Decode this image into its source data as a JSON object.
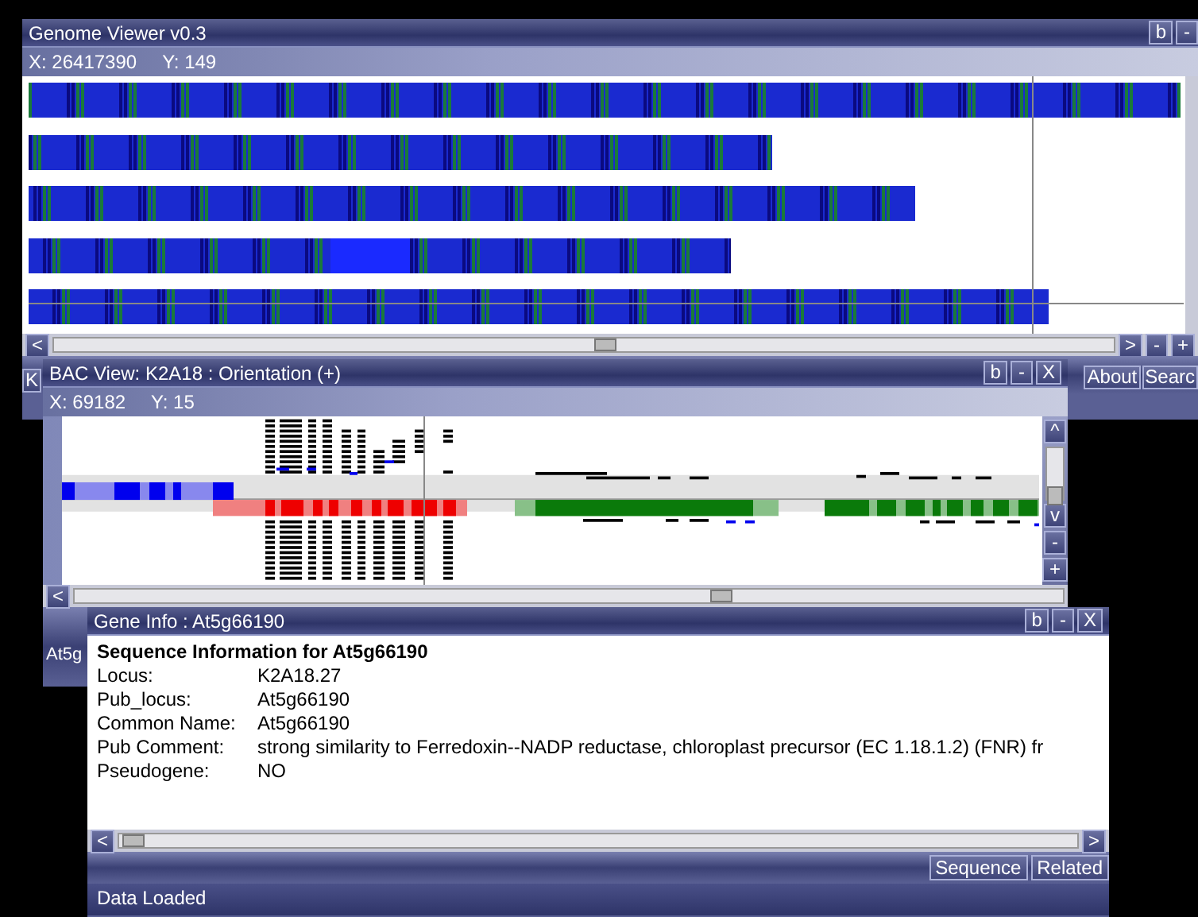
{
  "genome_window": {
    "title": "Genome Viewer v0.3",
    "title_buttons": [
      "b",
      "-"
    ],
    "x_coord": "X: 26417390",
    "y_coord": "Y: 149",
    "scroll_left": "<",
    "nav_buttons": [
      ">",
      "-",
      "+"
    ],
    "menu_buttons": [
      "About",
      "Searc"
    ],
    "side_label": "K"
  },
  "bac_window": {
    "title": "BAC View: K2A18 : Orientation (+)",
    "title_buttons": [
      "b",
      "-",
      "X"
    ],
    "x_coord": "X: 69182",
    "y_coord": "Y: 15",
    "side_buttons": [
      "^",
      "v",
      "-",
      "+"
    ],
    "scroll_left": "<",
    "footer_label": "At5g"
  },
  "gene_window": {
    "title": "Gene Info : At5g66190",
    "title_buttons": [
      "b",
      "-",
      "X"
    ],
    "heading": "Sequence Information for At5g66190",
    "fields": [
      {
        "label": "Locus:",
        "value": "K2A18.27"
      },
      {
        "label": "Pub_locus:",
        "value": "At5g66190"
      },
      {
        "label": "Common Name:",
        "value": "At5g66190"
      },
      {
        "label": "Pub Comment:",
        "value": "strong similarity to Ferredoxin--NADP reductase, chloroplast precursor (EC 1.18.1.2) (FNR) fr"
      },
      {
        "label": "Pseudogene:",
        "value": "NO"
      }
    ],
    "scroll_left": "<",
    "scroll_right": ">",
    "tabs": [
      "Sequence",
      "Related"
    ],
    "status": "Data Loaded"
  }
}
